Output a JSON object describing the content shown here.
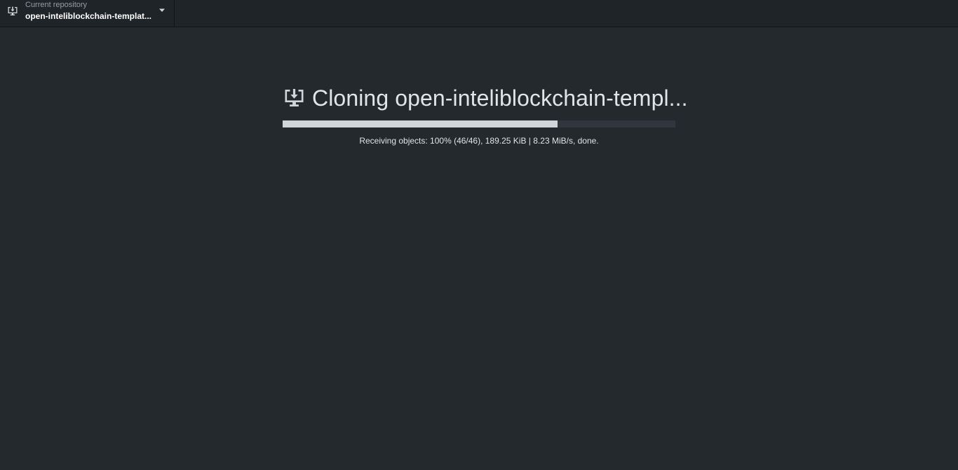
{
  "toolbar": {
    "repository": {
      "label": "Current repository",
      "name": "open-inteliblockchain-templat...",
      "icon": "clone-desktop-icon",
      "dropdown_icon": "caret-down-icon"
    }
  },
  "clone": {
    "icon": "clone-desktop-icon",
    "title": "Cloning open-inteliblockchain-templ...",
    "progress": 0.7,
    "status": "Receiving objects: 100% (46/46), 189.25 KiB | 8.23 MiB/s, done."
  },
  "colors": {
    "background": "#24292e",
    "toolbar": "#1f2428",
    "progress_fill": "#d1d5da",
    "progress_track": "#2f363d"
  }
}
